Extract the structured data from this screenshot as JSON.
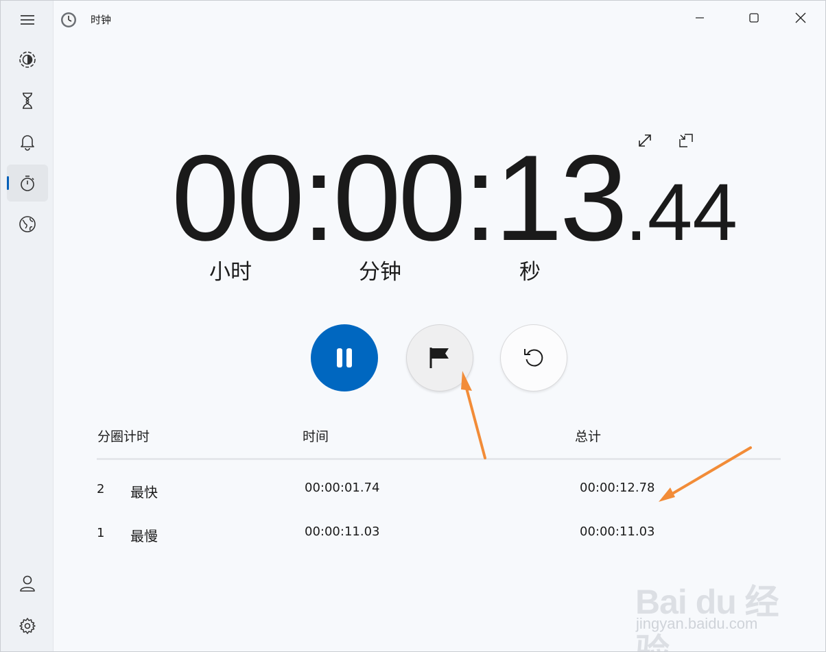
{
  "titlebar": {
    "title": "时钟"
  },
  "nav": {
    "menu": "menu-icon",
    "items": [
      {
        "name": "focus-sessions",
        "icon": "focus-icon",
        "active": false
      },
      {
        "name": "timer",
        "icon": "hourglass-icon",
        "active": false
      },
      {
        "name": "alarm",
        "icon": "bell-icon",
        "active": false
      },
      {
        "name": "stopwatch",
        "icon": "stopwatch-icon",
        "active": true
      },
      {
        "name": "world-clock",
        "icon": "globe-icon",
        "active": false
      }
    ],
    "bottom": [
      "account-icon",
      "settings-icon"
    ]
  },
  "stopwatch": {
    "hours": "00",
    "sep1": ":",
    "minutes": "00",
    "sep2": ":",
    "seconds": "13",
    "dot": ".",
    "fraction": "44",
    "hours_label": "小时",
    "minutes_label": "分钟",
    "seconds_label": "秒"
  },
  "laps": {
    "headers": {
      "lap": "分圈计时",
      "time": "时间",
      "total": "总计"
    },
    "rows": [
      {
        "num": "2",
        "tag": "最快",
        "time": "00:00:01.74",
        "total": "00:00:12.78"
      },
      {
        "num": "1",
        "tag": "最慢",
        "time": "00:00:11.03",
        "total": "00:00:11.03"
      }
    ]
  },
  "watermark": {
    "brand": "Bai du 经验",
    "url": "jingyan.baidu.com"
  },
  "colors": {
    "accent": "#0067c0",
    "annotation": "#f28c38",
    "indicator": "#005fb8"
  }
}
